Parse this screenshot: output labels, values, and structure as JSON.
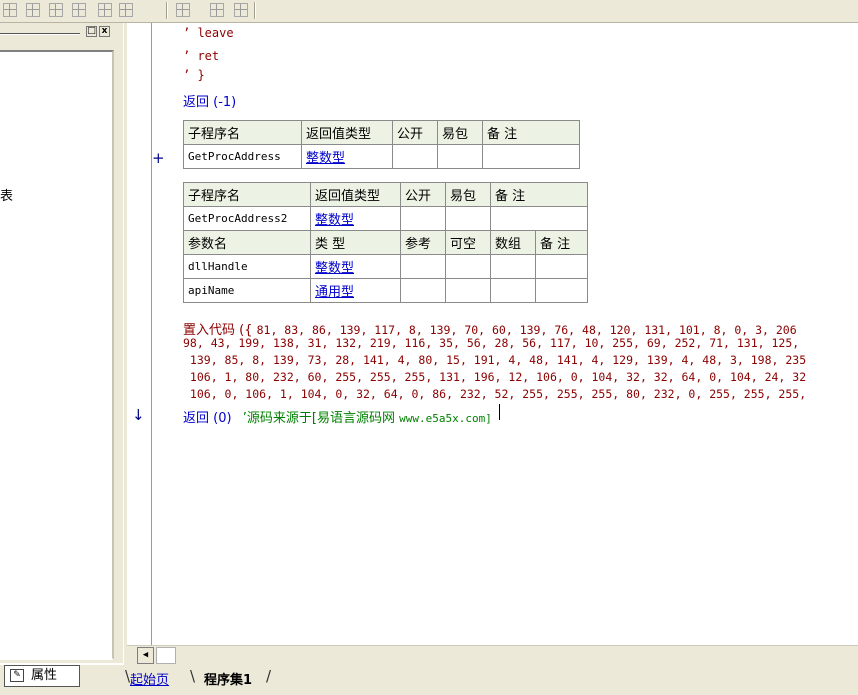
{
  "toolbar": {
    "icons": [
      "align-left-icon",
      "align-center-icon",
      "align-right-icon",
      "align-justify-icon",
      "horizontal-spacing-icon",
      "vertical-spacing-icon",
      "same-width-icon",
      "same-height-icon",
      "same-size-icon"
    ]
  },
  "left_panel": {
    "fragment_char": "表",
    "restore_glyph": "□",
    "close_glyph": "x"
  },
  "code": {
    "asm_lines": [
      "’ leave",
      "’ ret",
      "’ }"
    ],
    "return_line_1": "返回 (-1)",
    "table1": {
      "headers": [
        "子程序名",
        "返回值类型",
        "公开",
        "易包",
        "备 注"
      ],
      "row": {
        "name": "GetProcAddress",
        "type": "整数型"
      }
    },
    "table1_marker": "+",
    "table2": {
      "headers": [
        "子程序名",
        "返回值类型",
        "公开",
        "易包",
        "备 注"
      ],
      "row": {
        "name": "GetProcAddress2",
        "type": "整数型"
      },
      "param_headers": [
        "参数名",
        "类 型",
        "参考",
        "可空",
        "数组",
        "备 注"
      ],
      "params": [
        {
          "name": "dllHandle",
          "type": "整数型"
        },
        {
          "name": "apiName",
          "type": "通用型"
        }
      ]
    },
    "embed_keyword": "置入代码 ({ ",
    "embed_lines": [
      "81, 83, 86, 139, 117, 8, 139, 70, 60, 139, 76, 48, 120, 131, 101, 8, 0, 3, 206",
      "98, 43, 199, 138, 31, 132, 219, 116, 35, 56, 28, 56, 117, 10, 255, 69, 252, 71, 131, 125,",
      " 139, 85, 8, 139, 73, 28, 141, 4, 80, 15, 191, 4, 48, 141, 4, 129, 139, 4, 48, 3, 198, 235",
      " 106, 1, 80, 232, 60, 255, 255, 255, 131, 196, 12, 106, 0, 104, 32, 32, 64, 0, 104, 24, 32",
      " 106, 0, 106, 1, 104, 0, 32, 64, 0, 86, 232, 52, 255, 255, 255, 80, 232, 0, 255, 255, 255,"
    ],
    "return_line_2": "返回 (0)",
    "comment_prefix": "’源码来源于[易语言源码网 ",
    "comment_url": "www.e5a5x.com]",
    "arrow_marker": "↓"
  },
  "scrollbar": {
    "left_arrow": "◀"
  },
  "bottom_tabs": {
    "properties": "属性",
    "start_page": "起始页",
    "program_set": "程序集1"
  }
}
